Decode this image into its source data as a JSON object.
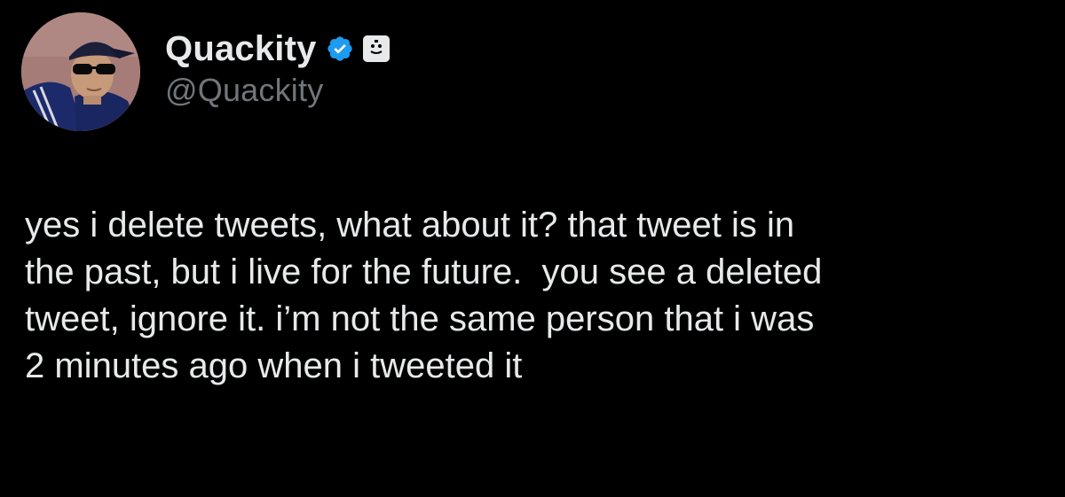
{
  "author": {
    "display_name": "Quackity",
    "handle": "@Quackity",
    "verified_icon": "verified-badge-icon",
    "affiliate_icon": "affiliate-badge-icon"
  },
  "tweet": {
    "text": "yes i delete tweets, what about it? that tweet is in\nthe past, but i live for the future.  you see a deleted\ntweet, ignore it. i’m not the same person that i was\n2 minutes ago when i tweeted it"
  },
  "colors": {
    "background": "#000000",
    "text_primary": "#e7e9ea",
    "text_secondary": "#71767b",
    "verified_blue": "#1d9bf0"
  }
}
